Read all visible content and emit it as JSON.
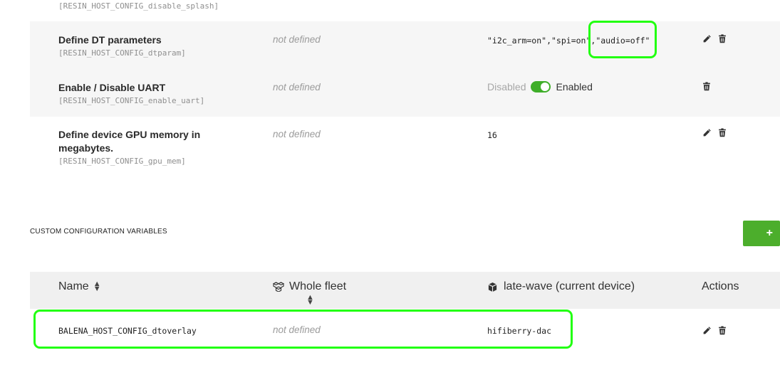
{
  "top_partial_row": {
    "key": "[RESIN_HOST_CONFIG_disable_splash]"
  },
  "rows": [
    {
      "title": "Define DT parameters",
      "key": "[RESIN_HOST_CONFIG_dtparam]",
      "fleet": "not defined",
      "value": "\"i2c_arm=on\",\"spi=on\",\"audio=off\""
    },
    {
      "title": "Enable / Disable UART",
      "key": "[RESIN_HOST_CONFIG_enable_uart]",
      "fleet": "not defined",
      "toggle_off_label": "Disabled",
      "toggle_on_label": "Enabled",
      "toggle_state": "on"
    },
    {
      "title_line1": "Define device GPU memory in",
      "title_line2": "megabytes.",
      "key": "[RESIN_HOST_CONFIG_gpu_mem]",
      "fleet": "not defined",
      "value": "16"
    }
  ],
  "custom_section": {
    "title": "CUSTOM CONFIGURATION VARIABLES",
    "add_label": "+",
    "columns": {
      "name": "Name",
      "fleet": "Whole fleet",
      "device": "late-wave (current device)",
      "actions": "Actions"
    },
    "row": {
      "name": "BALENA_HOST_CONFIG_dtoverlay",
      "fleet": "not defined",
      "device": "hifiberry-dac"
    }
  },
  "colors": {
    "accent": "#4cae2c",
    "highlight": "#22ff11",
    "muted": "#9b9b9b"
  },
  "icons": [
    "pencil-icon",
    "trash-icon",
    "cubes-icon",
    "cube-icon",
    "sort-icon"
  ]
}
